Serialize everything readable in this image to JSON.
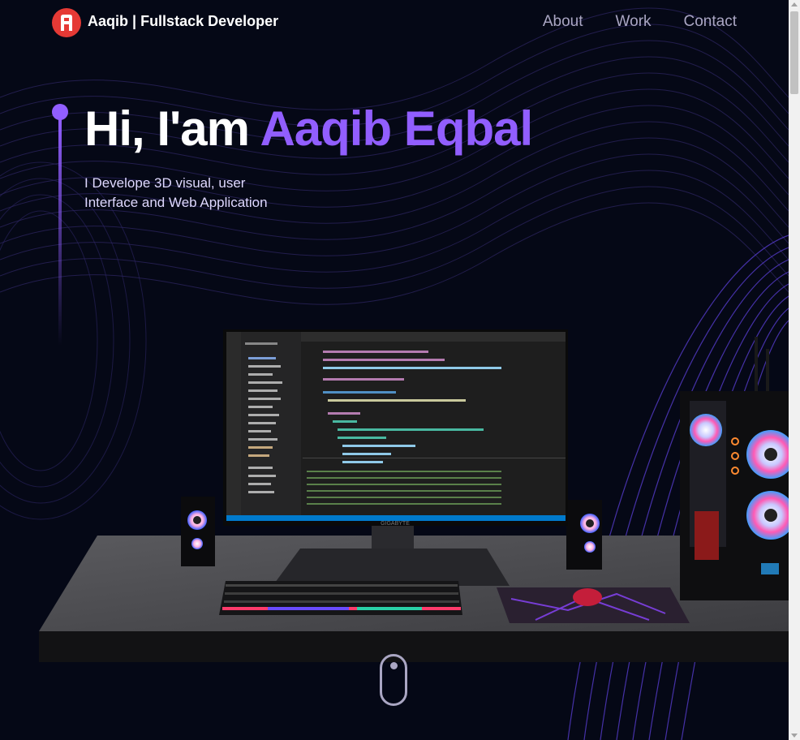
{
  "brand": {
    "name": "Aaqib",
    "title": "| Fullstack Developer",
    "logo_letter": "A"
  },
  "nav": [
    {
      "label": "About"
    },
    {
      "label": "Work"
    },
    {
      "label": "Contact"
    }
  ],
  "hero": {
    "greeting": "Hi, I'am",
    "name": "Aaqib Eqbal",
    "subtitle_line1": "I Develope 3D visual, user",
    "subtitle_line2": "Interface and Web Application"
  },
  "scene": {
    "monitor_brand": "GIGABYTE"
  },
  "colors": {
    "background": "#050816",
    "accent": "#915eff",
    "secondary_text": "#aaa6c3",
    "logo": "#e53935"
  },
  "icons": {
    "scroll_indicator": "mouse-scroll-icon",
    "logo": "logo-icon"
  }
}
